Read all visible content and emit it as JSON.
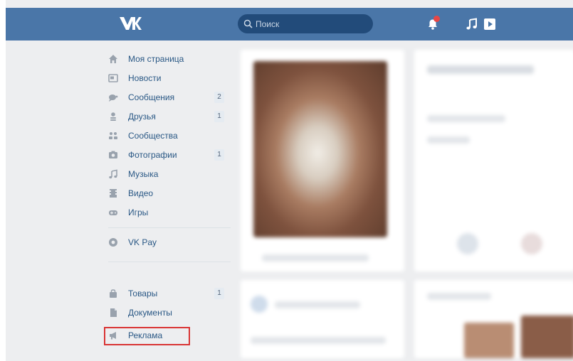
{
  "header": {
    "logo_text": "VK",
    "search_placeholder": "Поиск",
    "brand_color": "#4a76a8",
    "notification_color": "#e64646"
  },
  "sidebar": {
    "items": [
      {
        "label": "Моя страница",
        "icon": "home-icon"
      },
      {
        "label": "Новости",
        "icon": "news-icon"
      },
      {
        "label": "Сообщения",
        "icon": "messages-icon",
        "badge": "2"
      },
      {
        "label": "Друзья",
        "icon": "friends-icon",
        "badge": "1"
      },
      {
        "label": "Сообщества",
        "icon": "communities-icon"
      },
      {
        "label": "Фотографии",
        "icon": "camera-icon",
        "badge": "1"
      },
      {
        "label": "Музыка",
        "icon": "music-note-icon"
      },
      {
        "label": "Видео",
        "icon": "video-icon"
      },
      {
        "label": "Игры",
        "icon": "gamepad-icon"
      }
    ],
    "pay": {
      "label": "VK Pay",
      "icon": "vk-pay-icon"
    },
    "extra": [
      {
        "label": "Товары",
        "icon": "shopping-bag-icon",
        "badge": "1"
      },
      {
        "label": "Документы",
        "icon": "document-icon"
      },
      {
        "label": "Реклама",
        "icon": "megaphone-icon"
      }
    ],
    "highlight_color": "#d93434"
  }
}
